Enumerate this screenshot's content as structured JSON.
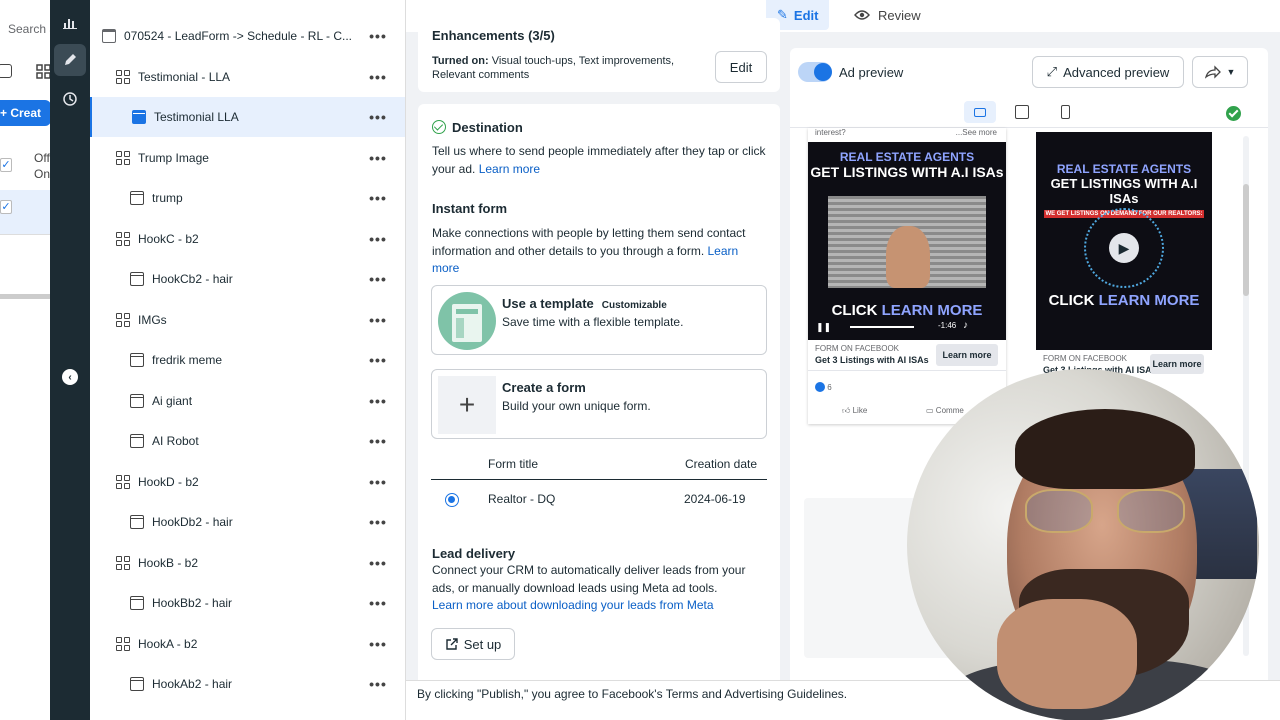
{
  "campaigns_panel": {
    "search_placeholder": "Search a",
    "create_label": "+ Creat",
    "column_header": "Off\nOn"
  },
  "nav_strip": {
    "items": [
      {
        "icon": "bar-chart-icon"
      },
      {
        "icon": "pencil-icon"
      },
      {
        "icon": "history-clock-icon"
      }
    ],
    "collapse_icon": "chevron-left-icon"
  },
  "tree": {
    "items": [
      {
        "label": "070524 - LeadForm -> Schedule - RL - C...",
        "type": "campaign"
      },
      {
        "label": "Testimonial - LLA",
        "type": "adset"
      },
      {
        "label": "Testimonial LLA",
        "type": "ad",
        "selected": true
      },
      {
        "label": "Trump Image",
        "type": "adset"
      },
      {
        "label": "trump",
        "type": "ad"
      },
      {
        "label": "HookC - b2",
        "type": "adset"
      },
      {
        "label": "HookCb2 - hair",
        "type": "ad"
      },
      {
        "label": "IMGs",
        "type": "adset"
      },
      {
        "label": "fredrik meme",
        "type": "ad"
      },
      {
        "label": "Ai giant",
        "type": "ad"
      },
      {
        "label": "AI Robot",
        "type": "ad"
      },
      {
        "label": "HookD - b2",
        "type": "adset"
      },
      {
        "label": "HookDb2 - hair",
        "type": "ad"
      },
      {
        "label": "HookB - b2",
        "type": "adset"
      },
      {
        "label": "HookBb2 - hair",
        "type": "ad"
      },
      {
        "label": "HookA - b2",
        "type": "adset"
      },
      {
        "label": "HookAb2 - hair",
        "type": "ad"
      }
    ],
    "more_label": "•••"
  },
  "topbar": {
    "edit_label": "Edit",
    "review_label": "Review"
  },
  "enhancements": {
    "title": "Enhancements (3/5)",
    "turned_on_label": "Turned on:",
    "turned_on_value": "Visual touch-ups, Text improvements, Relevant comments",
    "edit_label": "Edit"
  },
  "destination": {
    "title": "Destination",
    "desc": "Tell us where to send people immediately after they tap or click your ad.",
    "learn_more": "Learn more",
    "instant_form_title": "Instant form",
    "instant_form_desc": "Make connections with people by letting them send contact information and other details to you through a form.",
    "instant_form_learn_more": "Learn more",
    "template_title": "Use a template",
    "template_badge": "Customizable",
    "template_desc": "Save time with a flexible template.",
    "create_title": "Create a form",
    "create_desc": "Build your own unique form.",
    "table_headers": [
      "Form title",
      "Creation date"
    ],
    "forms": [
      {
        "title": "Realtor - DQ",
        "date": "2024-06-19",
        "selected": true
      }
    ],
    "lead_delivery_title": "Lead delivery",
    "lead_delivery_desc": "Connect your CRM to automatically deliver leads from your ads, or manually download leads using Meta ad tools.",
    "lead_delivery_link": "Learn more about downloading your leads from Meta",
    "setup_label": "Set up"
  },
  "preview": {
    "toggle_label": "Ad preview",
    "toggle_on": true,
    "advanced_label": "Advanced preview",
    "share_icon": "share-arrow-icon",
    "devices": [
      "responsive-icon",
      "desktop-icon",
      "mobile-icon"
    ],
    "status_icon": "check-circle-icon",
    "ad1": {
      "top_text": "interest?",
      "see_more": "...See more",
      "headline_1": "REAL ESTATE AGENTS",
      "headline_2": "GET LISTINGS WITH A.I ISAs",
      "cta_1": "CLICK",
      "cta_2": "LEARN MORE",
      "time": "-1:46",
      "footer_label": "FORM ON FACEBOOK",
      "footer_title": "Get 3 Listings with AI ISAs",
      "learn_more": "Learn more",
      "reactions": "6",
      "like": "Like",
      "comment": "Comme"
    },
    "ad2": {
      "headline_1": "REAL ESTATE AGENTS",
      "headline_2": "GET LISTINGS WITH A.I ISAs",
      "subline": "WE GET LISTINGS ON DEMAND FOR OUR REALTORS:",
      "cta_1": "CLICK",
      "cta_2": "LEARN MORE",
      "footer_label": "FORM ON FACEBOOK",
      "footer_title": "Get 3 Listings with AI ISAs",
      "learn_more": "Learn more"
    }
  },
  "bottombar": {
    "text": "By clicking \"Publish,\" you agree to Facebook's Terms and Advertising Guidelines."
  },
  "colors": {
    "accent": "#1b74e4",
    "nav_dark": "#1c2b33",
    "success": "#31a24c"
  }
}
